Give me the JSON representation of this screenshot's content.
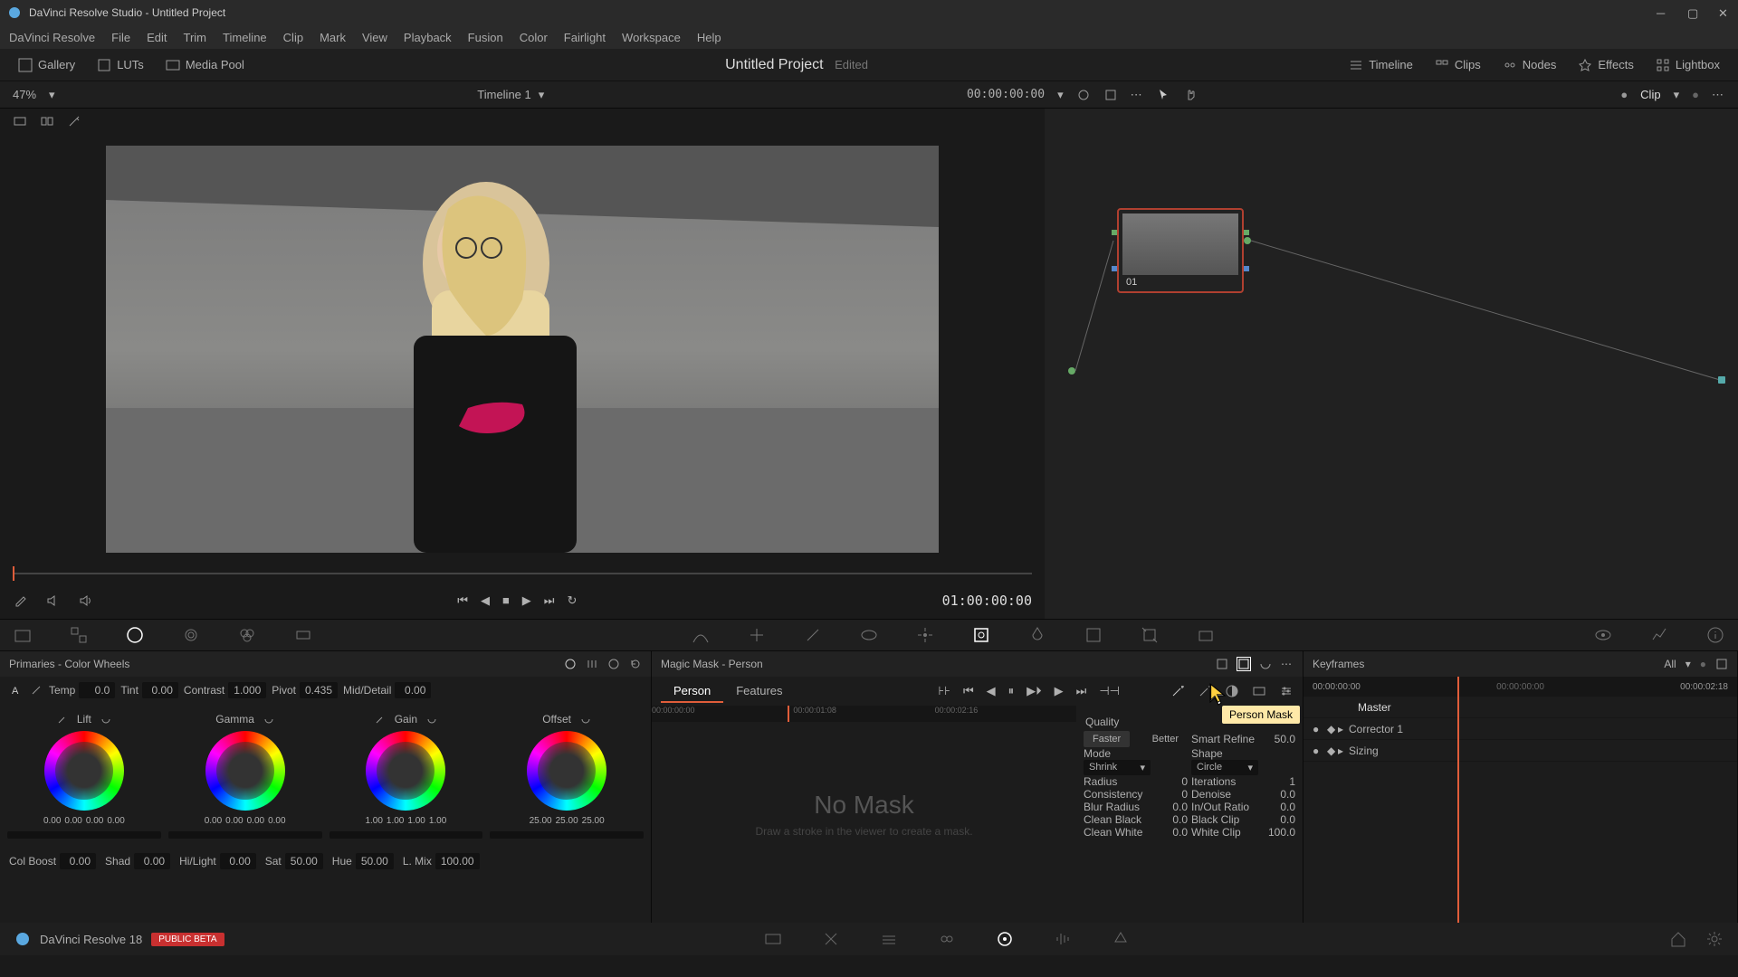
{
  "window": {
    "title": "DaVinci Resolve Studio - Untitled Project"
  },
  "menu": [
    "DaVinci Resolve",
    "File",
    "Edit",
    "Trim",
    "Timeline",
    "Clip",
    "Mark",
    "View",
    "Playback",
    "Fusion",
    "Color",
    "Fairlight",
    "Workspace",
    "Help"
  ],
  "toolbar": {
    "gallery": "Gallery",
    "luts": "LUTs",
    "mediapool": "Media Pool",
    "project": "Untitled Project",
    "edited": "Edited",
    "timeline": "Timeline",
    "clips": "Clips",
    "nodes": "Nodes",
    "effects": "Effects",
    "lightbox": "Lightbox"
  },
  "subtoolbar": {
    "zoom": "47%",
    "timeline_name": "Timeline 1",
    "timecode": "00:00:00:00",
    "clip_mode": "Clip"
  },
  "transport": {
    "timecode": "01:00:00:00"
  },
  "node": {
    "label": "01"
  },
  "primaries": {
    "title": "Primaries - Color Wheels",
    "temp": {
      "label": "Temp",
      "value": "0.0"
    },
    "tint": {
      "label": "Tint",
      "value": "0.00"
    },
    "contrast": {
      "label": "Contrast",
      "value": "1.000"
    },
    "pivot": {
      "label": "Pivot",
      "value": "0.435"
    },
    "middetail": {
      "label": "Mid/Detail",
      "value": "0.00"
    },
    "wheels": [
      {
        "name": "Lift",
        "vals": [
          "0.00",
          "0.00",
          "0.00",
          "0.00"
        ]
      },
      {
        "name": "Gamma",
        "vals": [
          "0.00",
          "0.00",
          "0.00",
          "0.00"
        ]
      },
      {
        "name": "Gain",
        "vals": [
          "1.00",
          "1.00",
          "1.00",
          "1.00"
        ]
      },
      {
        "name": "Offset",
        "vals": [
          "25.00",
          "25.00",
          "25.00"
        ]
      }
    ],
    "colboost": {
      "label": "Col Boost",
      "value": "0.00"
    },
    "shad": {
      "label": "Shad",
      "value": "0.00"
    },
    "hilight": {
      "label": "Hi/Light",
      "value": "0.00"
    },
    "sat": {
      "label": "Sat",
      "value": "50.00"
    },
    "hue": {
      "label": "Hue",
      "value": "50.00"
    },
    "lmix": {
      "label": "L. Mix",
      "value": "100.00"
    }
  },
  "magicmask": {
    "title": "Magic Mask - Person",
    "tabs": {
      "person": "Person",
      "features": "Features"
    },
    "tooltip": "Person Mask",
    "nomask": "No Mask",
    "nomask_sub": "Draw a stroke in the viewer to create a mask.",
    "tc": [
      "00:00:00:00",
      "00:00:01:08",
      "00:00:02:16"
    ],
    "params": {
      "quality_label": "Quality",
      "faster": "Faster",
      "better": "Better",
      "smartrefine": {
        "label": "Smart Refine",
        "value": "50.0"
      },
      "mode_label": "Mode",
      "mode_value": "Shrink",
      "shape_label": "Shape",
      "shape_value": "Circle",
      "radius": {
        "label": "Radius",
        "value": "0"
      },
      "iterations": {
        "label": "Iterations",
        "value": "1"
      },
      "consistency": {
        "label": "Consistency",
        "value": "0"
      },
      "denoise": {
        "label": "Denoise",
        "value": "0.0"
      },
      "blurradius": {
        "label": "Blur Radius",
        "value": "0.0"
      },
      "inout": {
        "label": "In/Out Ratio",
        "value": "0.0"
      },
      "cleanblack": {
        "label": "Clean Black",
        "value": "0.0"
      },
      "blackclip": {
        "label": "Black Clip",
        "value": "0.0"
      },
      "cleanwhite": {
        "label": "Clean White",
        "value": "0.0"
      },
      "whiteclip": {
        "label": "White Clip",
        "value": "100.0"
      }
    }
  },
  "keyframes": {
    "title": "Keyframes",
    "all": "All",
    "tc_start": "00:00:00:00",
    "tc_end": "00:00:02:18",
    "master": "Master",
    "corrector": "Corrector 1",
    "sizing": "Sizing"
  },
  "footer": {
    "version": "DaVinci Resolve 18",
    "beta": "PUBLIC BETA"
  }
}
